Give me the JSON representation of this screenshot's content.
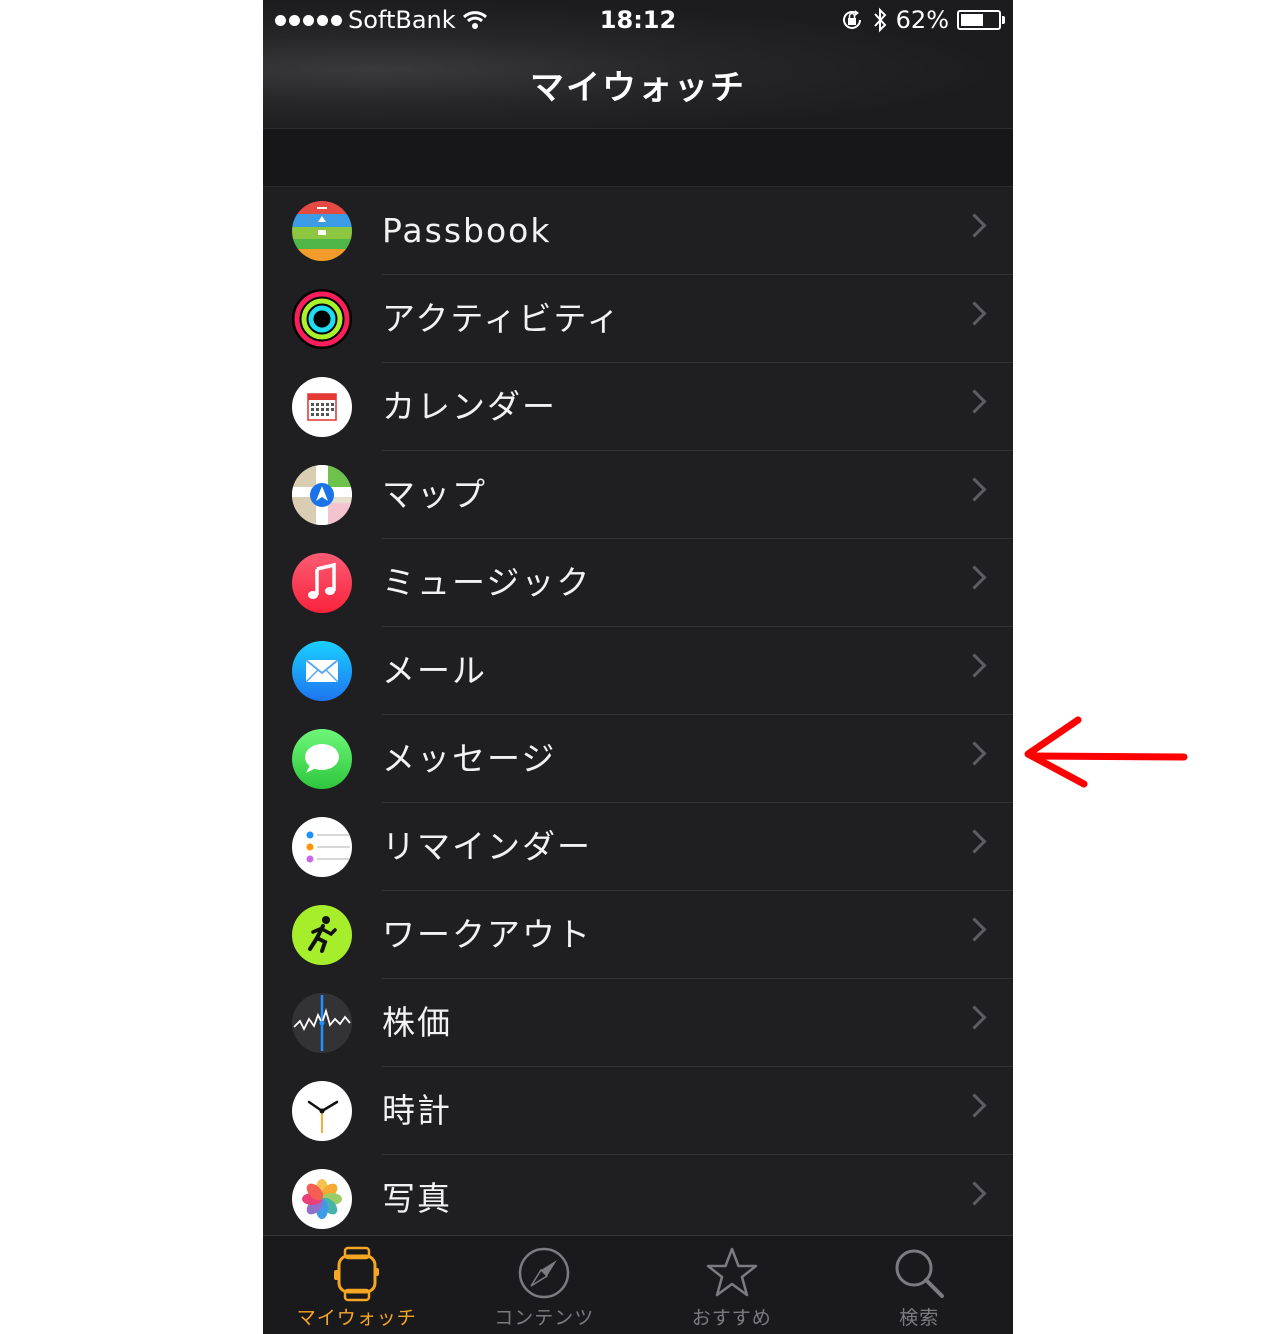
{
  "status_bar": {
    "carrier": "SoftBank",
    "time": "18:12",
    "battery_percent": "62%",
    "battery_level": 0.62
  },
  "nav": {
    "title": "マイウォッチ"
  },
  "apps": [
    {
      "label": "Passbook",
      "icon": "passbook-icon"
    },
    {
      "label": "アクティビティ",
      "icon": "activity-icon"
    },
    {
      "label": "カレンダー",
      "icon": "calendar-icon"
    },
    {
      "label": "マップ",
      "icon": "maps-icon"
    },
    {
      "label": "ミュージック",
      "icon": "music-icon"
    },
    {
      "label": "メール",
      "icon": "mail-icon"
    },
    {
      "label": "メッセージ",
      "icon": "messages-icon"
    },
    {
      "label": "リマインダー",
      "icon": "reminders-icon"
    },
    {
      "label": "ワークアウト",
      "icon": "workout-icon"
    },
    {
      "label": "株価",
      "icon": "stocks-icon"
    },
    {
      "label": "時計",
      "icon": "clock-icon"
    },
    {
      "label": "写真",
      "icon": "photos-icon"
    }
  ],
  "tabs": [
    {
      "label": "マイウォッチ",
      "icon": "watch-icon",
      "active": true
    },
    {
      "label": "コンテンツ",
      "icon": "compass-icon",
      "active": false
    },
    {
      "label": "おすすめ",
      "icon": "star-icon",
      "active": false
    },
    {
      "label": "検索",
      "icon": "search-icon",
      "active": false
    }
  ],
  "colors": {
    "accent": "#f5a623",
    "annotation_arrow": "#ff0000",
    "background": "#1f1f21"
  }
}
